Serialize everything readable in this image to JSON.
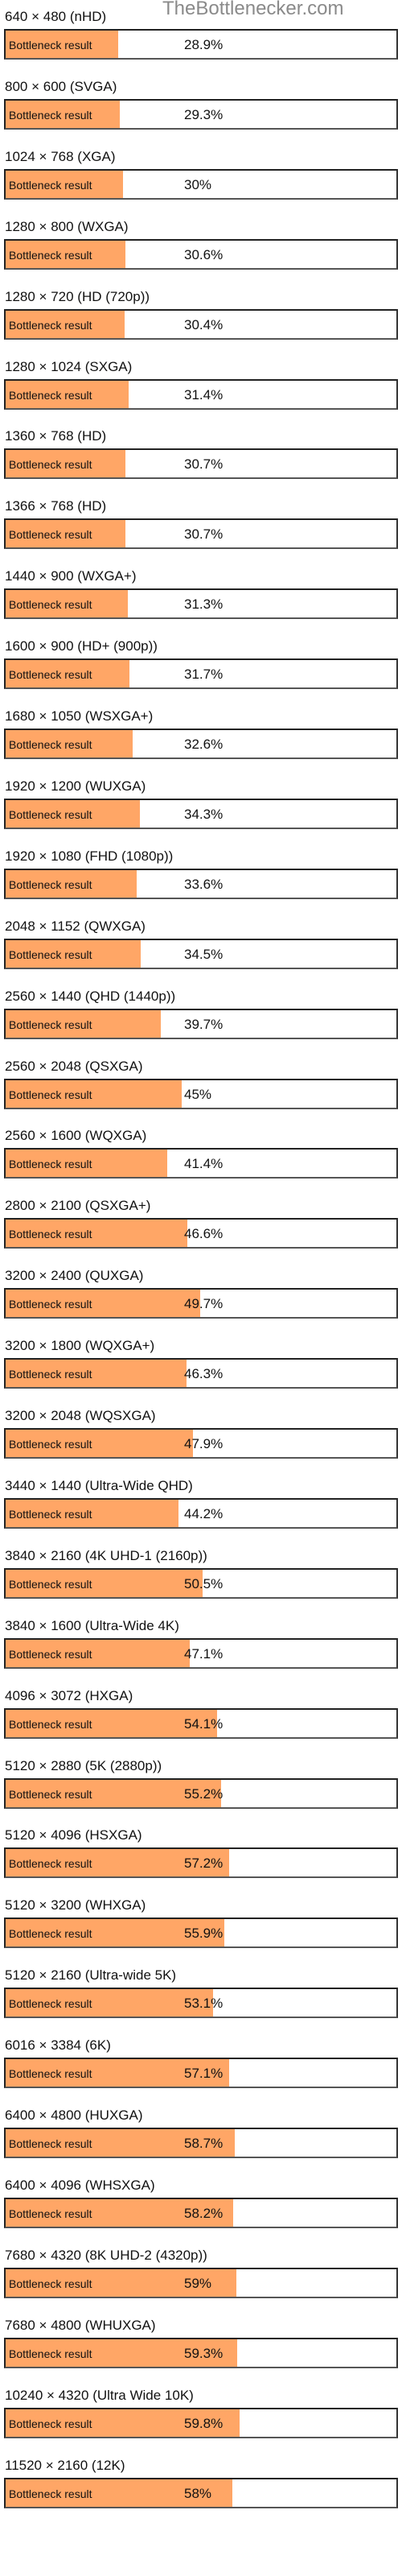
{
  "site": {
    "watermark": "TheBottlenecker.com"
  },
  "colors": {
    "fill": "#ffa666",
    "border": "#222222",
    "watermark": "#8a8a8a"
  },
  "bar_label": "Bottleneck result",
  "chart_data": {
    "type": "bar",
    "orientation": "horizontal",
    "title": "",
    "xlabel": "",
    "ylabel": "",
    "xlim": [
      0,
      100
    ],
    "categories": [
      "640 × 480 (nHD)",
      "800 × 600 (SVGA)",
      "1024 × 768 (XGA)",
      "1280 × 800 (WXGA)",
      "1280 × 720 (HD (720p))",
      "1280 × 1024 (SXGA)",
      "1360 × 768 (HD)",
      "1366 × 768 (HD)",
      "1440 × 900 (WXGA+)",
      "1600 × 900 (HD+ (900p))",
      "1680 × 1050 (WSXGA+)",
      "1920 × 1200 (WUXGA)",
      "1920 × 1080 (FHD (1080p))",
      "2048 × 1152 (QWXGA)",
      "2560 × 1440 (QHD (1440p))",
      "2560 × 2048 (QSXGA)",
      "2560 × 1600 (WQXGA)",
      "2800 × 2100 (QSXGA+)",
      "3200 × 2400 (QUXGA)",
      "3200 × 1800 (WQXGA+)",
      "3200 × 2048 (WQSXGA)",
      "3440 × 1440 (Ultra-Wide QHD)",
      "3840 × 2160 (4K UHD-1 (2160p))",
      "3840 × 1600 (Ultra-Wide 4K)",
      "4096 × 3072 (HXGA)",
      "5120 × 2880 (5K (2880p))",
      "5120 × 4096 (HSXGA)",
      "5120 × 3200 (WHXGA)",
      "5120 × 2160 (Ultra-wide 5K)",
      "6016 × 3384 (6K)",
      "6400 × 4800 (HUXGA)",
      "6400 × 4096 (WHSXGA)",
      "7680 × 4320 (8K UHD-2 (4320p))",
      "7680 × 4800 (WHUXGA)",
      "10240 × 4320 (Ultra Wide 10K)",
      "11520 × 2160 (12K)"
    ],
    "values": [
      28.9,
      29.3,
      30,
      30.6,
      30.4,
      31.4,
      30.7,
      30.7,
      31.3,
      31.7,
      32.6,
      34.3,
      33.6,
      34.5,
      39.7,
      45,
      41.4,
      46.6,
      49.7,
      46.3,
      47.9,
      44.2,
      50.5,
      47.1,
      54.1,
      55.2,
      57.2,
      55.9,
      53.1,
      57.1,
      58.7,
      58.2,
      59,
      59.3,
      59.8,
      58
    ],
    "value_labels": [
      "28.9%",
      "29.3%",
      "30%",
      "30.6%",
      "30.4%",
      "31.4%",
      "30.7%",
      "30.7%",
      "31.3%",
      "31.7%",
      "32.6%",
      "34.3%",
      "33.6%",
      "34.5%",
      "39.7%",
      "45%",
      "41.4%",
      "46.6%",
      "49.7%",
      "46.3%",
      "47.9%",
      "44.2%",
      "50.5%",
      "47.1%",
      "54.1%",
      "55.2%",
      "57.2%",
      "55.9%",
      "53.1%",
      "57.1%",
      "58.7%",
      "58.2%",
      "59%",
      "59.3%",
      "59.8%",
      "58%"
    ]
  }
}
